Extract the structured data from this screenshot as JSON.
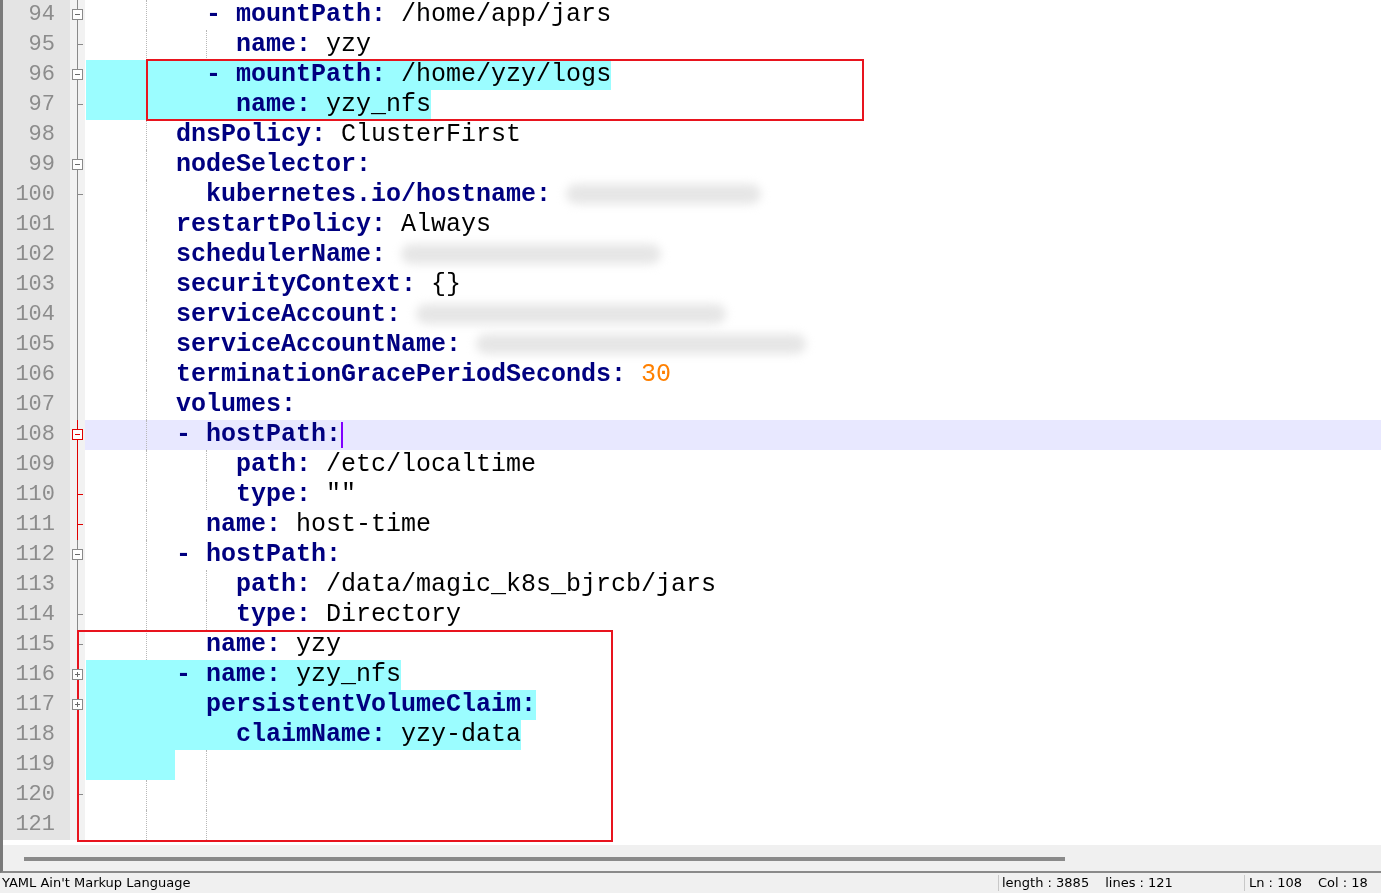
{
  "editor": {
    "lines": [
      {
        "number": "94",
        "kind": "fold_open",
        "tokens": [
          {
            "kind": "dash",
            "text": "        -"
          },
          {
            "kind": "key",
            "text": "mountPath:"
          },
          {
            "kind": "value",
            "text": "/home/app/jars"
          }
        ]
      },
      {
        "number": "95",
        "kind": "fold_end",
        "tokens": [
          {
            "kind": "key",
            "text": "          name:"
          },
          {
            "kind": "value",
            "text": "yzy"
          }
        ]
      },
      {
        "number": "96",
        "kind": "fold_open",
        "highlighted": true,
        "tokens": [
          {
            "kind": "dash",
            "text": "        -"
          },
          {
            "kind": "key",
            "text": "mountPath:"
          },
          {
            "kind": "value",
            "text": "/home/yzy/logs"
          }
        ]
      },
      {
        "number": "97",
        "kind": "fold_end",
        "highlighted": true,
        "tokens": [
          {
            "kind": "key",
            "text": "          name:"
          },
          {
            "kind": "value",
            "text": "yzy_nfs"
          }
        ]
      },
      {
        "number": "98",
        "kind": "plain",
        "tokens": [
          {
            "kind": "key",
            "text": "      dnsPolicy:"
          },
          {
            "kind": "value",
            "text": "ClusterFirst"
          }
        ]
      },
      {
        "number": "99",
        "kind": "fold_open",
        "tokens": [
          {
            "kind": "key",
            "text": "      nodeSelector:"
          }
        ]
      },
      {
        "number": "100",
        "kind": "fold_end",
        "tokens": [
          {
            "kind": "key",
            "text": "        kubernetes.io/hostname:"
          },
          {
            "kind": "redacted"
          }
        ]
      },
      {
        "number": "101",
        "kind": "plain",
        "tokens": [
          {
            "kind": "key",
            "text": "      restartPolicy:"
          },
          {
            "kind": "value",
            "text": "Always"
          }
        ]
      },
      {
        "number": "102",
        "kind": "plain",
        "tokens": [
          {
            "kind": "key",
            "text": "      schedulerName:"
          },
          {
            "kind": "redacted"
          }
        ]
      },
      {
        "number": "103",
        "kind": "plain",
        "tokens": [
          {
            "kind": "key",
            "text": "      securityContext:"
          },
          {
            "kind": "value",
            "text": "{}"
          }
        ]
      },
      {
        "number": "104",
        "kind": "plain",
        "tokens": [
          {
            "kind": "key",
            "text": "      serviceAccount:"
          },
          {
            "kind": "redacted"
          }
        ]
      },
      {
        "number": "105",
        "kind": "plain",
        "tokens": [
          {
            "kind": "key",
            "text": "      serviceAccountName:"
          },
          {
            "kind": "redacted"
          }
        ]
      },
      {
        "number": "106",
        "kind": "plain",
        "tokens": [
          {
            "kind": "key",
            "text": "      terminationGracePeriodSeconds:"
          },
          {
            "kind": "number",
            "text": "30"
          }
        ]
      },
      {
        "number": "107",
        "kind": "plain",
        "tokens": [
          {
            "kind": "key",
            "text": "      volumes:"
          }
        ]
      },
      {
        "number": "108",
        "kind": "fold_open",
        "fold_active": true,
        "current": true,
        "cursor": true,
        "tokens": [
          {
            "kind": "dash",
            "text": "      -"
          },
          {
            "kind": "key",
            "text": "hostPath:"
          }
        ]
      },
      {
        "number": "109",
        "kind": "plain",
        "fold_active": true,
        "tokens": [
          {
            "kind": "key",
            "text": "          path:"
          },
          {
            "kind": "value",
            "text": "/etc/localtime"
          }
        ]
      },
      {
        "number": "110",
        "kind": "fold_end",
        "fold_active": true,
        "tokens": [
          {
            "kind": "key",
            "text": "          type:"
          },
          {
            "kind": "value",
            "text": "\"\""
          }
        ]
      },
      {
        "number": "111",
        "kind": "fold_end",
        "fold_active": true,
        "tokens": [
          {
            "kind": "key",
            "text": "        name:"
          },
          {
            "kind": "value",
            "text": "host-time"
          }
        ]
      },
      {
        "number": "112",
        "kind": "fold_open",
        "tokens": [
          {
            "kind": "dash",
            "text": "      -"
          },
          {
            "kind": "key",
            "text": "hostPath:"
          }
        ]
      },
      {
        "number": "113",
        "kind": "plain",
        "tokens": [
          {
            "kind": "key",
            "text": "          path:"
          },
          {
            "kind": "value",
            "text": "/data/magic_k8s_bjrcb/jars"
          }
        ]
      },
      {
        "number": "114",
        "kind": "fold_end",
        "tokens": [
          {
            "kind": "key",
            "text": "          type:"
          },
          {
            "kind": "value",
            "text": "Directory"
          }
        ]
      },
      {
        "number": "115",
        "kind": "fold_end",
        "tokens": [
          {
            "kind": "key",
            "text": "        name:"
          },
          {
            "kind": "value",
            "text": "yzy"
          }
        ]
      },
      {
        "number": "116",
        "kind": "fold_closed",
        "highlighted": true,
        "tokens": [
          {
            "kind": "dash",
            "text": "      -"
          },
          {
            "kind": "key",
            "text": "name:"
          },
          {
            "kind": "value",
            "text": "yzy_nfs"
          }
        ]
      },
      {
        "number": "117",
        "kind": "fold_closed",
        "highlighted": true,
        "tokens": [
          {
            "kind": "key",
            "text": "        persistentVolumeClaim:"
          }
        ]
      },
      {
        "number": "118",
        "kind": "plain",
        "highlighted": true,
        "tokens": [
          {
            "kind": "key",
            "text": "          claimName:"
          },
          {
            "kind": "value",
            "text": "yzy-data"
          }
        ]
      },
      {
        "number": "119",
        "kind": "plain",
        "highlighted": true
      },
      {
        "number": "120",
        "kind": "fold_end"
      },
      {
        "number": "121",
        "kind": "plain"
      }
    ]
  },
  "status_bar": {
    "language": "YAML Ain't Markup Language",
    "length": "length : 3885",
    "lines": "lines : 121",
    "position": "Ln : 108",
    "column": "Col : 18"
  }
}
